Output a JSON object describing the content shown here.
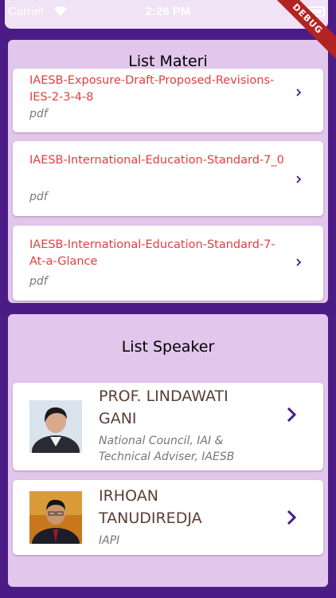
{
  "status_bar": {
    "carrier": "Carrier",
    "time": "2:26 PM"
  },
  "debug_banner": "DEBUG",
  "materi": {
    "title": "List Materi",
    "items": [
      {
        "name": "IAESB-Exposure-Draft-Proposed-Revisions-IES-2-3-4-8",
        "type": "pdf"
      },
      {
        "name": "IAESB-International-Education-Standard-7_0",
        "type": "pdf"
      },
      {
        "name": "IAESB-International-Education-Standard-7-At-a-Glance",
        "type": "pdf"
      }
    ]
  },
  "speaker": {
    "title": "List Speaker",
    "items": [
      {
        "name": "PROF. LINDAWATI GANI",
        "role": "National Council, IAI & Technical Adviser, IAESB"
      },
      {
        "name": "IRHOAN TANUDIREDJA",
        "role": "IAPI"
      }
    ]
  },
  "colors": {
    "background": "#4b1c86",
    "panel": "#e2c6ec",
    "materi_name": "#e03f3f",
    "speaker_name": "#5a3e35",
    "chevron": "#4a1a8a"
  },
  "icons": [
    "wifi-icon",
    "battery-icon",
    "chevron-right-icon",
    "speaker-photo"
  ]
}
